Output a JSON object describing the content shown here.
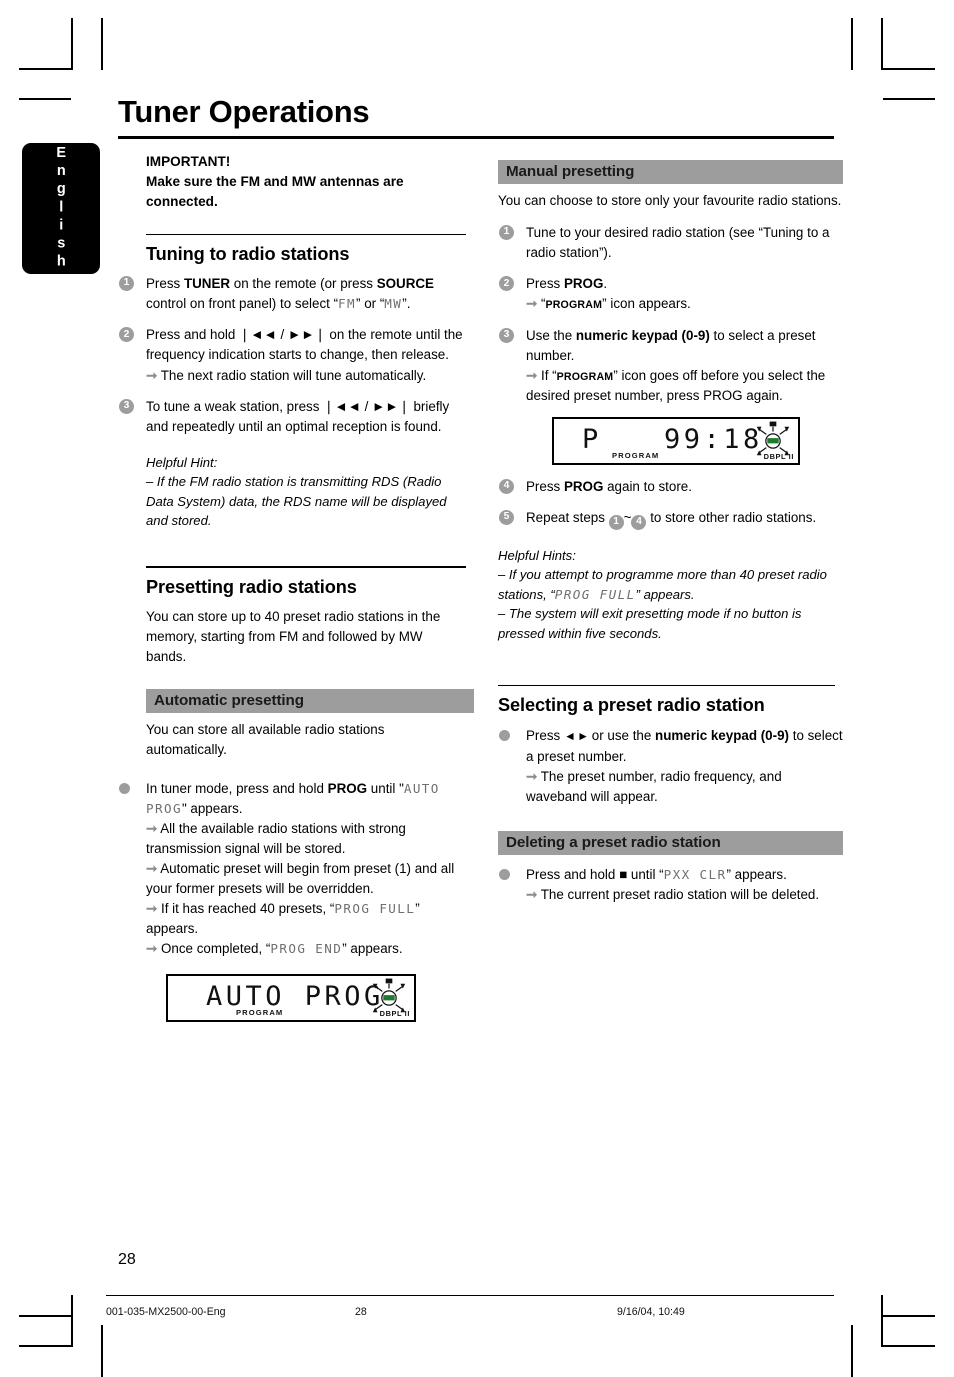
{
  "document": {
    "title": "Tuner Operations",
    "language_tab": "English",
    "page_number": "28"
  },
  "colors": {
    "bar_header_bg": "#9d9d9d",
    "step_marker_bg": "#9d9d9d",
    "arrow": "#8d8d8d",
    "lcd_text": "#6f6f6f"
  },
  "left_column": {
    "important": {
      "line1": "IMPORTANT!",
      "line2": "Make sure the FM and MW antennas are",
      "line3": "connected."
    },
    "tuning": {
      "heading": "Tuning to radio stations",
      "steps": [
        {
          "num": "1",
          "pre": "Press ",
          "b1": "TUNER",
          "mid1": " on the remote (or press ",
          "b2": "SOURCE",
          "mid2": " control on front panel) to select “",
          "lcd1": "FM",
          "mid3": "” or “",
          "lcd2": "MW",
          "post": "”."
        },
        {
          "num": "2",
          "text": "Press and hold ❘◄◄ / ►►❘ on the remote until the frequency indication starts to change, then release.",
          "result": "The next radio station will tune automatically."
        },
        {
          "num": "3",
          "text": "To tune a weak station, press ❘◄◄ / ►►❘ briefly and repeatedly until an optimal reception is found."
        }
      ],
      "hint_title": "Helpful Hint:",
      "hint_body": "–  If the FM radio station is transmitting RDS (Radio Data System) data, the RDS name will be displayed and stored."
    },
    "presetting": {
      "heading": "Presetting radio stations",
      "body": "You can store up to 40 preset radio stations in the memory, starting from FM and followed by MW bands."
    },
    "automatic": {
      "bar_heading": "Automatic presetting",
      "body": "You can store all available radio stations automatically.",
      "bullet": {
        "pre": "In tuner mode, press and hold ",
        "bold": "PROG",
        "mid": " until \"",
        "lcd": "AUTO PROG",
        "post": "\" appears."
      },
      "results": [
        "All the available radio stations with strong transmission signal will be stored.",
        "Automatic preset will begin from preset (1) and all your former presets will be overridden."
      ],
      "result3_pre": "If it has reached 40 presets, “",
      "result3_lcd": "PROG FULL",
      "result3_post": "” appears.",
      "result4_pre": "Once completed, “",
      "result4_lcd": "PROG END",
      "result4_post": "” appears."
    },
    "display_figure": {
      "segment_text": "AUTO PROG",
      "program_label": "PROGRAM",
      "dbpl_label": "DBPL II"
    }
  },
  "right_column": {
    "manual": {
      "bar_heading": "Manual presetting",
      "body": "You can choose to store only your favourite radio stations.",
      "steps": [
        {
          "num": "1",
          "text": "Tune to your desired radio station (see “Tuning to a radio station”)."
        },
        {
          "num": "2",
          "pre": "Press ",
          "bold": "PROG",
          "post": ".",
          "result_pre": "“",
          "result_sc": "PROGRAM",
          "result_post": "” icon appears."
        },
        {
          "num": "3",
          "pre": "Use the ",
          "bold": "numeric keypad (0-9)",
          "post": " to select a preset number.",
          "result_pre": "If “",
          "result_sc": "PROGRAM",
          "result_post": "” icon goes off before you select the desired preset number, press PROG again."
        },
        {
          "num": "4",
          "pre": "Press ",
          "bold": "PROG",
          "post": " again to store."
        },
        {
          "num": "5",
          "pre": "Repeat steps ",
          "from": "1",
          "tilde": "~",
          "to": "4",
          "post": " to store other radio stations."
        }
      ],
      "hints_title": "Helpful Hints:",
      "hint1_pre": "–  If you attempt to programme more than 40 preset radio stations, “",
      "hint1_lcd": "PROG FULL",
      "hint1_post": "” appears.",
      "hint2": "–  The system will exit presetting mode if no button is pressed within five seconds."
    },
    "display_figure": {
      "segment_p": "P",
      "segment_number": "99:18",
      "program_label": "PROGRAM",
      "dbpl_label": "DBPL II"
    },
    "selecting": {
      "heading": "Selecting a preset radio station",
      "bullet_pre": "Press ",
      "bullet_glyphs": "◄ ►",
      "bullet_mid": " or use the ",
      "bullet_bold": "numeric keypad (0-9)",
      "bullet_post": " to select a preset number.",
      "result": "The preset number, radio frequency, and waveband will appear."
    },
    "deleting": {
      "bar_heading": "Deleting a preset radio station",
      "bullet_pre": "Press and hold ",
      "bullet_glyph": "■",
      "bullet_mid": " until “",
      "bullet_lcd": "PXX CLR",
      "bullet_post": "” appears.",
      "result": "The current preset radio station will be deleted."
    }
  },
  "footer": {
    "file": "001-035-MX2500-00-Eng",
    "page": "28",
    "timestamp": "9/16/04, 10:49"
  }
}
